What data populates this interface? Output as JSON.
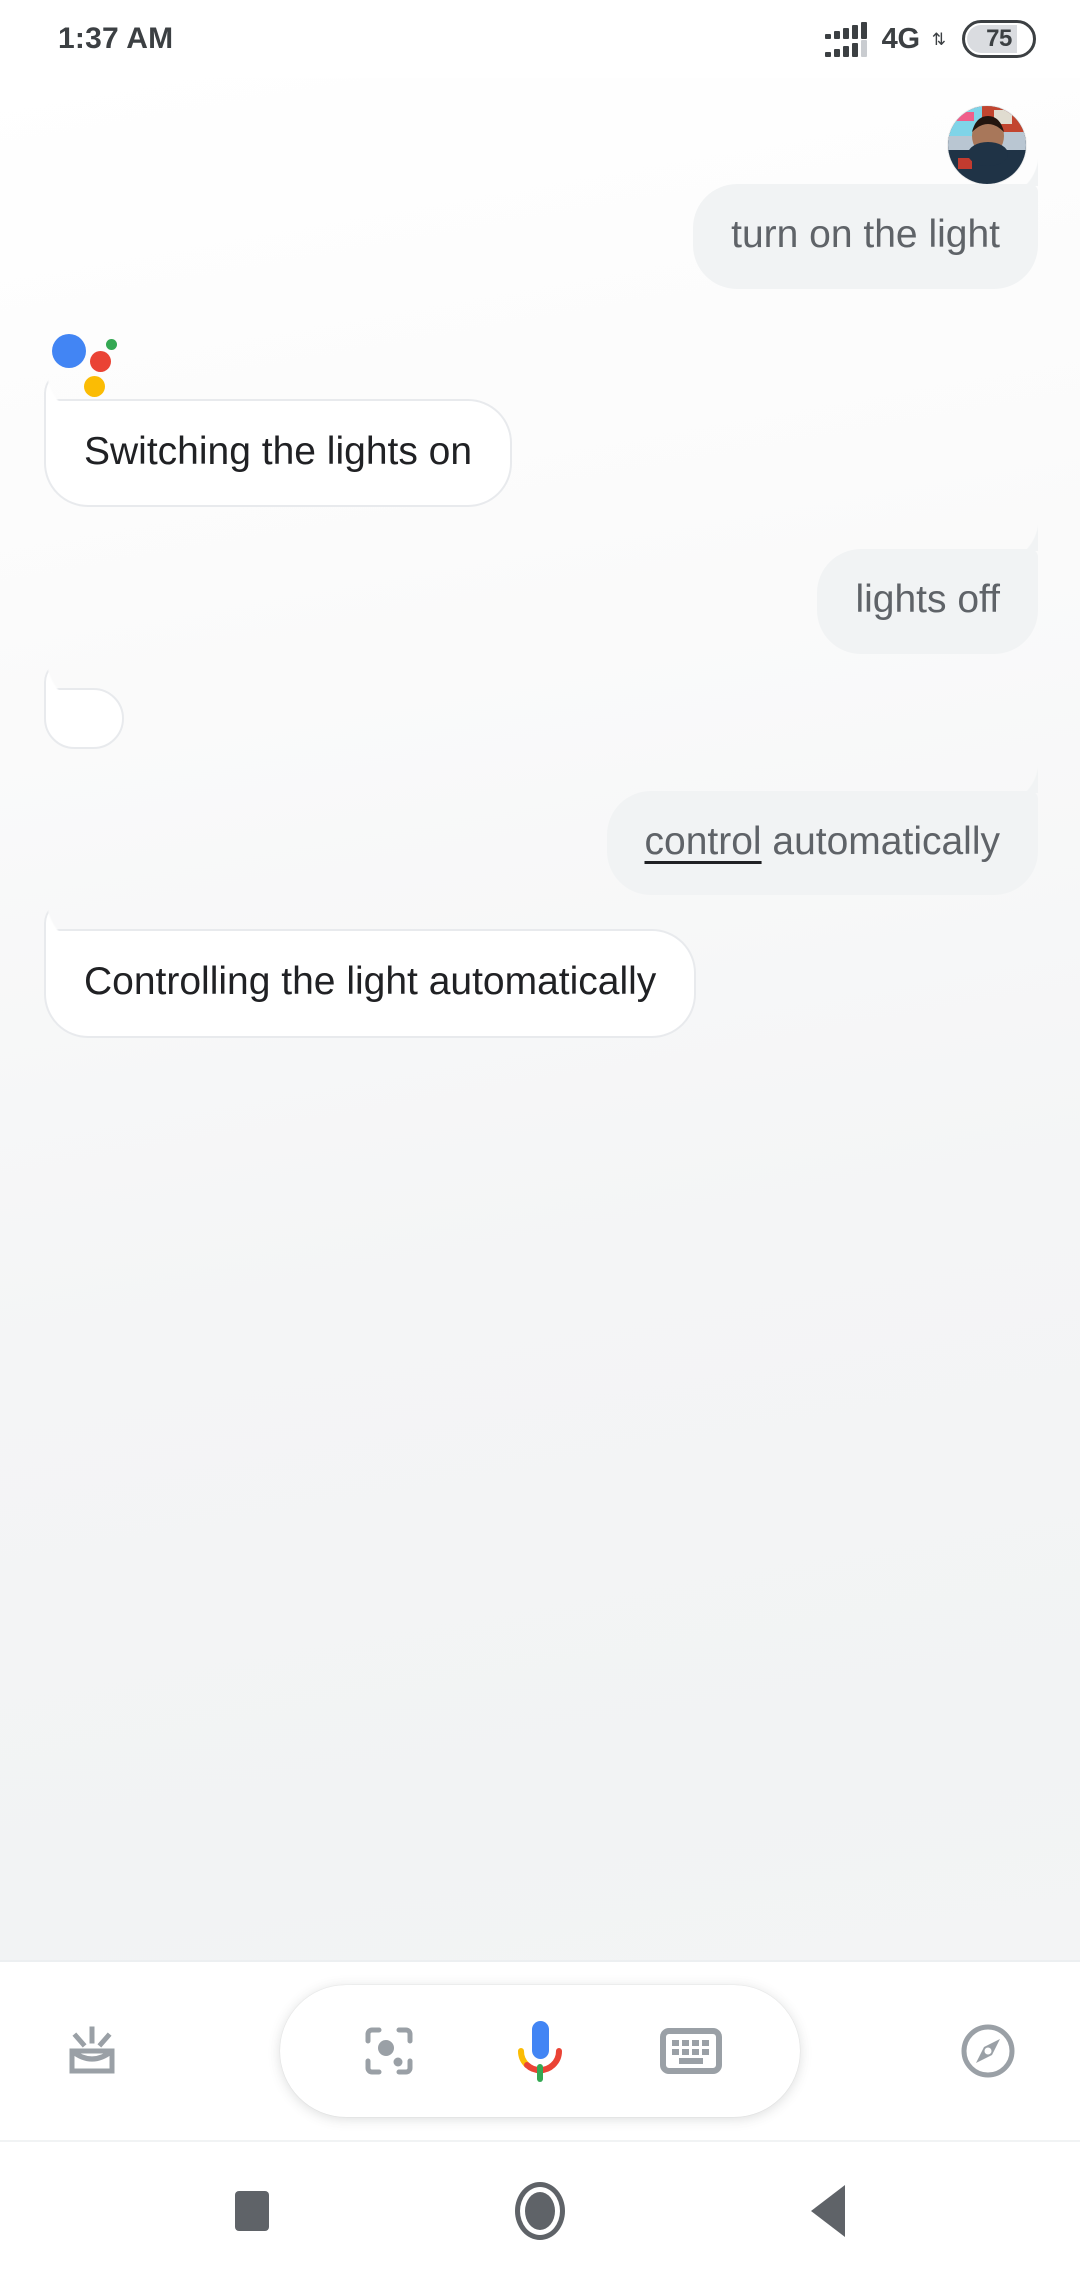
{
  "status_bar": {
    "time": "1:37 AM",
    "network_type": "4G",
    "data_arrows": "⇅",
    "battery_level": "75",
    "signal_icon": "signal-bars-icon",
    "battery_icon": "battery-icon"
  },
  "conversation": {
    "avatar_name": "user-avatar",
    "assistant_logo_name": "google-assistant-logo",
    "messages": [
      {
        "sender": "user",
        "text": "turn on the light"
      },
      {
        "sender": "assistant",
        "text": "Switching the lights on"
      },
      {
        "sender": "user",
        "text": "lights off"
      },
      {
        "sender": "user",
        "text_corrected": "control",
        "text_rest": " automatically",
        "full_text": "control automatically"
      },
      {
        "sender": "assistant",
        "text": "Controlling the light automatically"
      }
    ]
  },
  "toolbar": {
    "snapshot_icon": "snapshot-inbox-icon",
    "lens_icon": "google-lens-icon",
    "mic_icon": "microphone-icon",
    "keyboard_icon": "keyboard-icon",
    "explore_icon": "explore-compass-icon"
  },
  "nav_bar": {
    "recents_icon": "recents-square-icon",
    "home_icon": "home-circle-icon",
    "back_icon": "back-triangle-icon"
  },
  "colors": {
    "google_blue": "#4285f4",
    "google_red": "#ea4335",
    "google_yellow": "#fbbc04",
    "google_green": "#34a853",
    "user_bubble": "#f1f3f4",
    "user_text": "#5f6368",
    "assistant_text": "#202124",
    "icon_gray": "#9aa0a6"
  }
}
